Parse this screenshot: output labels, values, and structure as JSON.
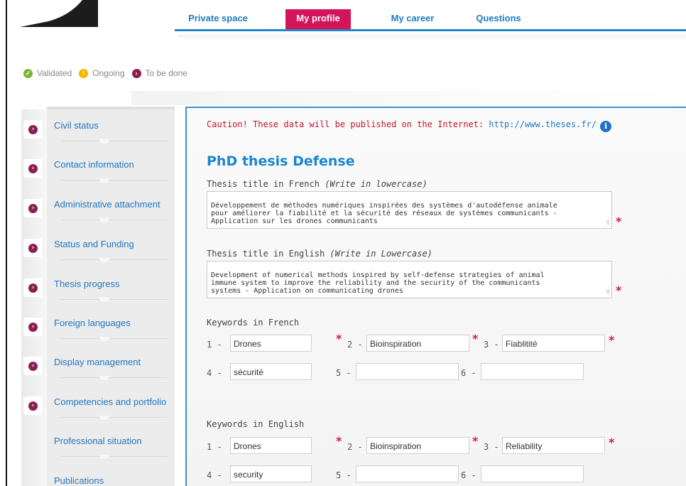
{
  "nav": {
    "tabs": [
      {
        "label": "Private space",
        "active": false
      },
      {
        "label": "My profile",
        "active": true
      },
      {
        "label": "My career",
        "active": false
      },
      {
        "label": "Questions",
        "active": false
      }
    ],
    "active_color": "#d4145a",
    "link_color": "#1e7cc2"
  },
  "legend": {
    "validated": "Validated",
    "ongoing": "Ongoing",
    "to_be_done": "To be done"
  },
  "sidebar": {
    "items": [
      {
        "label": "Civil status"
      },
      {
        "label": "Contact information"
      },
      {
        "label": "Administrative attachment"
      },
      {
        "label": "Status and Funding"
      },
      {
        "label": "Thesis progress"
      },
      {
        "label": "Foreign languages"
      },
      {
        "label": "Display management"
      },
      {
        "label": "Competencies and portfolio"
      },
      {
        "label": "Professional situation"
      },
      {
        "label": "Publications"
      }
    ]
  },
  "form": {
    "caution_text": "Caution! These data will be published on the Internet:",
    "caution_link": "http://www.theses.fr/",
    "heading": "PhD thesis Defense",
    "title_fr_label": "Thesis title in French",
    "title_fr_hint": "(Write in lowercase)",
    "title_fr_value": "Développement de méthodes numériques inspirées des systèmes d'autodéfense animale\npour améliorer la fiabilité et la sécurité des réseaux de systèmes communicants -\nApplication sur les drones communicants",
    "title_en_label": "Thesis title in English",
    "title_en_hint": "(Write in Lowercase)",
    "title_en_value": "Development of numerical methods inspired by self-defense strategies of animal\nimmune system to improve the reliability and the security of the communicants\nsystems - Application on communicating drones",
    "keywords_fr_label": "Keywords in French",
    "keywords_fr": [
      "Drones",
      "Bioinspiration",
      "Fiablitité",
      "sécurité",
      "",
      ""
    ],
    "keywords_en_label": "Keywords in English",
    "keywords_en": [
      "Drones",
      "Bioinspiration",
      "Reliability",
      "security",
      "",
      ""
    ],
    "kw_numbers": [
      "1 -",
      "2 -",
      "3 -",
      "4 -",
      "5 -",
      "6 -"
    ],
    "required_mark": "*",
    "info_icon": "i"
  }
}
